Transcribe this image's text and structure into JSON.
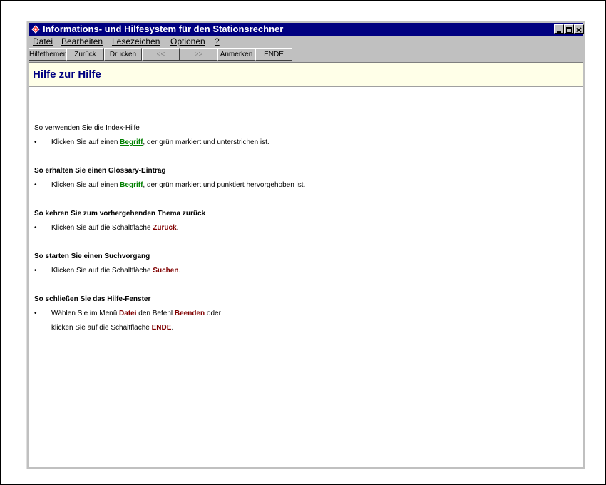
{
  "window": {
    "title": "Informations- und Hilfesystem für den Stationsrechner"
  },
  "menu": {
    "items": [
      "Datei",
      "Bearbeiten",
      "Lesezeichen",
      "Optionen",
      "?"
    ]
  },
  "toolbar": {
    "buttons": [
      "Hilfethemen",
      "Zurück",
      "Drucken",
      "<<",
      ">>",
      "Anmerken",
      "ENDE"
    ]
  },
  "page": {
    "title": "Hilfe zur Hilfe"
  },
  "sections": [
    {
      "title": "So verwenden Sie die Index-Hilfe",
      "bullet": "•",
      "line1": {
        "pre": "Klicken Sie auf einen ",
        "term": "Begriff",
        "post": ", der grün markiert und unterstrichen ist."
      }
    },
    {
      "title": "So erhalten Sie einen Glossary-Eintrag",
      "bullet": "•",
      "line1": {
        "pre": "Klicken Sie auf einen ",
        "term": "Begriff",
        "post": ", der grün markiert und punktiert hervorgehoben ist."
      }
    },
    {
      "title": "So kehren Sie zum vorhergehenden Thema zurück",
      "bullet": "•",
      "line1": {
        "pre": "Klicken Sie auf die Schaltfläche ",
        "term": "Zurück",
        "post": "."
      }
    },
    {
      "title": "So starten Sie einen Suchvorgang",
      "bullet": "•",
      "line1": {
        "pre": "Klicken Sie auf die Schaltfläche ",
        "term": "Suchen",
        "post": "."
      }
    },
    {
      "title": "So schließen Sie das Hilfe-Fenster",
      "bullet": "•",
      "line1": {
        "pre": "Wählen Sie im Menü ",
        "term": "Datei",
        "mid": " den Befehl ",
        "term2": "Beenden",
        "post": " oder"
      },
      "line2": {
        "pre": "klicken Sie auf die Schaltfläche ",
        "term": "ENDE",
        "post": "."
      }
    }
  ],
  "colors": {
    "titlebar": "#000080",
    "link_green": "#008000",
    "keyword_red": "#800000",
    "header_band": "#ffffe8"
  }
}
